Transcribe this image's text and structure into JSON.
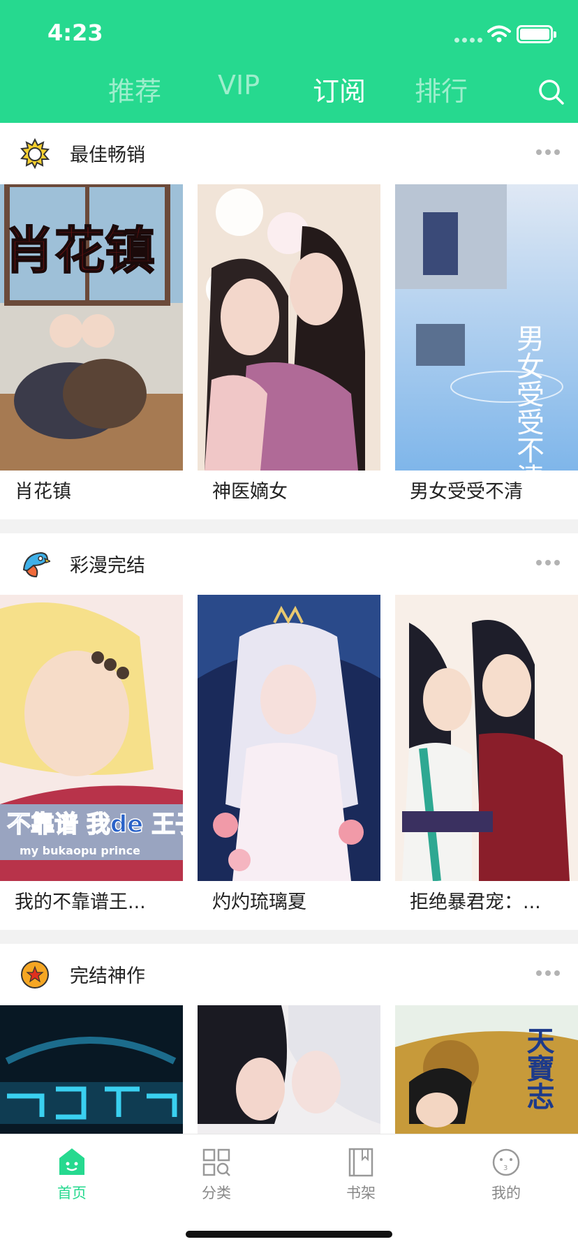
{
  "status": {
    "time": "4:23"
  },
  "tabs": [
    {
      "label": "推荐",
      "active": false
    },
    {
      "label": "VIP",
      "active": false
    },
    {
      "label": "订阅",
      "active": true
    },
    {
      "label": "排行",
      "active": false
    }
  ],
  "sections": [
    {
      "title": "最佳畅销",
      "icon": "sun-badge-icon",
      "items": [
        {
          "title": "肖花镇",
          "cover_text": "肖花镇"
        },
        {
          "title": "神医嫡女"
        },
        {
          "title": "男女受受不清",
          "cover_text": "男女受受不清"
        }
      ]
    },
    {
      "title": "彩漫完结",
      "icon": "parrot-icon",
      "items": [
        {
          "title": "我的不靠谱王...",
          "cover_text": "不靠谱 我de 王子殿下",
          "cover_subtext": "my bukaopu prince"
        },
        {
          "title": "灼灼琉璃夏"
        },
        {
          "title": "拒绝暴君宠：..."
        }
      ]
    },
    {
      "title": "完结神作",
      "icon": "star-ball-icon",
      "items": [
        {
          "title": ""
        },
        {
          "title": ""
        },
        {
          "title": "",
          "cover_text": "天寶志"
        }
      ]
    }
  ],
  "tabbar": [
    {
      "label": "首页",
      "icon": "home-icon",
      "active": true
    },
    {
      "label": "分类",
      "icon": "category-icon",
      "active": false
    },
    {
      "label": "书架",
      "icon": "bookshelf-icon",
      "active": false
    },
    {
      "label": "我的",
      "icon": "profile-icon",
      "active": false
    }
  ],
  "colors": {
    "accent": "#26d98f",
    "inactive": "#888888"
  }
}
